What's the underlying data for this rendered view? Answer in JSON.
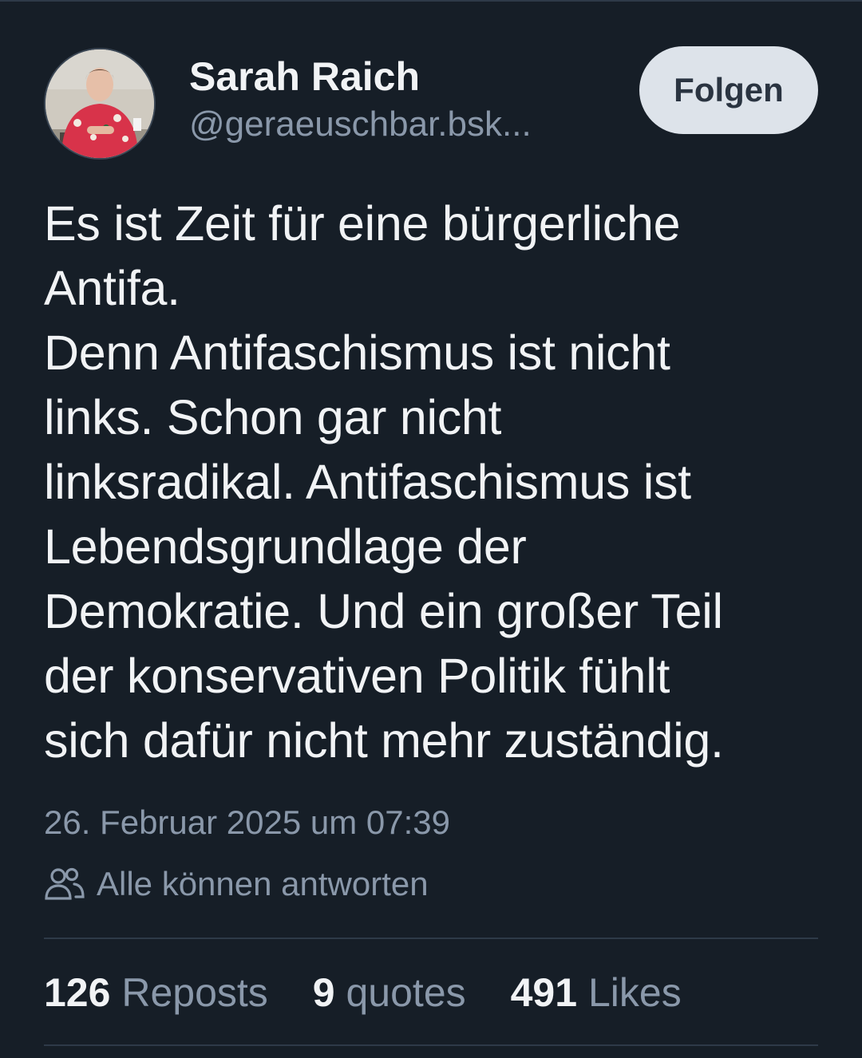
{
  "author": {
    "display_name": "Sarah Raich",
    "handle": "@geraeuschbar.bsk..."
  },
  "actions": {
    "follow_label": "Folgen"
  },
  "post": {
    "text": "Es ist Zeit für eine bürgerliche\nAntifa.\nDenn Antifaschismus ist nicht\nlinks. Schon gar nicht\nlinksradikal. Antifaschismus ist\nLebendsgrundlage der\nDemokratie. Und ein großer Teil\nder konservativen Politik fühlt\nsich dafür nicht mehr zuständig.",
    "timestamp": "26. Februar 2025 um 07:39",
    "reply_setting": "Alle können antworten",
    "reply_icon": "users-icon"
  },
  "stats": [
    {
      "count": "126",
      "label": "Reposts"
    },
    {
      "count": "9",
      "label": "quotes"
    },
    {
      "count": "491",
      "label": "Likes"
    }
  ],
  "colors": {
    "background": "#161e27",
    "text": "#f1f3f5",
    "muted": "#8a98aa",
    "divider": "#2e3a48",
    "follow_bg": "#dde3ea",
    "follow_text": "#2a3441"
  }
}
